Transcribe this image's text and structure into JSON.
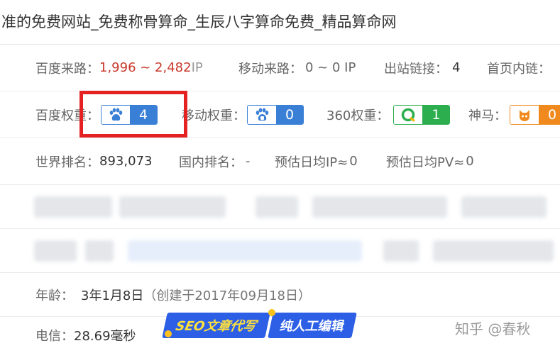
{
  "title": "准的免费网站_免费称骨算命_生辰八字算命免费_精品算命网",
  "row1": {
    "baidu_source_label": "百度来路：",
    "baidu_source_value": "1,996 ~ 2,482",
    "baidu_source_unit": " IP",
    "mobile_source_label": "移动来路：",
    "mobile_source_value": "0 ~ 0 IP",
    "outbound_label": "出站链接：",
    "outbound_value": "4",
    "home_inlinks_label": "首页内链："
  },
  "row2": {
    "baidu_weight_label": "百度权重：",
    "baidu_weight_value": "4",
    "mobile_weight_label": "移动权重：",
    "mobile_weight_value": "0",
    "weight360_label": "360权重：",
    "weight360_value": "1",
    "shenma_label": "神马：",
    "shenma_value": "0"
  },
  "row3": {
    "world_rank_label": "世界排名：",
    "world_rank_value": "893,073",
    "domestic_rank_label": "国内排名：",
    "domestic_rank_value": "-",
    "daily_ip_label": "预估日均IP≈",
    "daily_ip_value": "0",
    "daily_pv_label": "预估日均PV≈",
    "daily_pv_value": "0"
  },
  "row6": {
    "age_label": "年龄：",
    "age_value": "3年1月8日",
    "created_note": "（创建于2017年09月18日）"
  },
  "row7": {
    "telecom_label": "电信：",
    "telecom_value": "28.69毫秒"
  },
  "seo_banner": {
    "part1": "SEO文章代写",
    "part2": "纯人工编辑"
  },
  "watermark": "知乎 @春秋",
  "colors": {
    "baidu_blue": "#3a7fd6",
    "green_360": "#2cae4e",
    "shenma_orange": "#f08a1e",
    "highlight_red": "#e52222",
    "red_value": "#c8382b"
  },
  "icons": {
    "baidu": "paw-icon",
    "mobile": "paw-mobile-icon",
    "so360": "ring-360-icon",
    "shenma": "cat-face-icon"
  }
}
